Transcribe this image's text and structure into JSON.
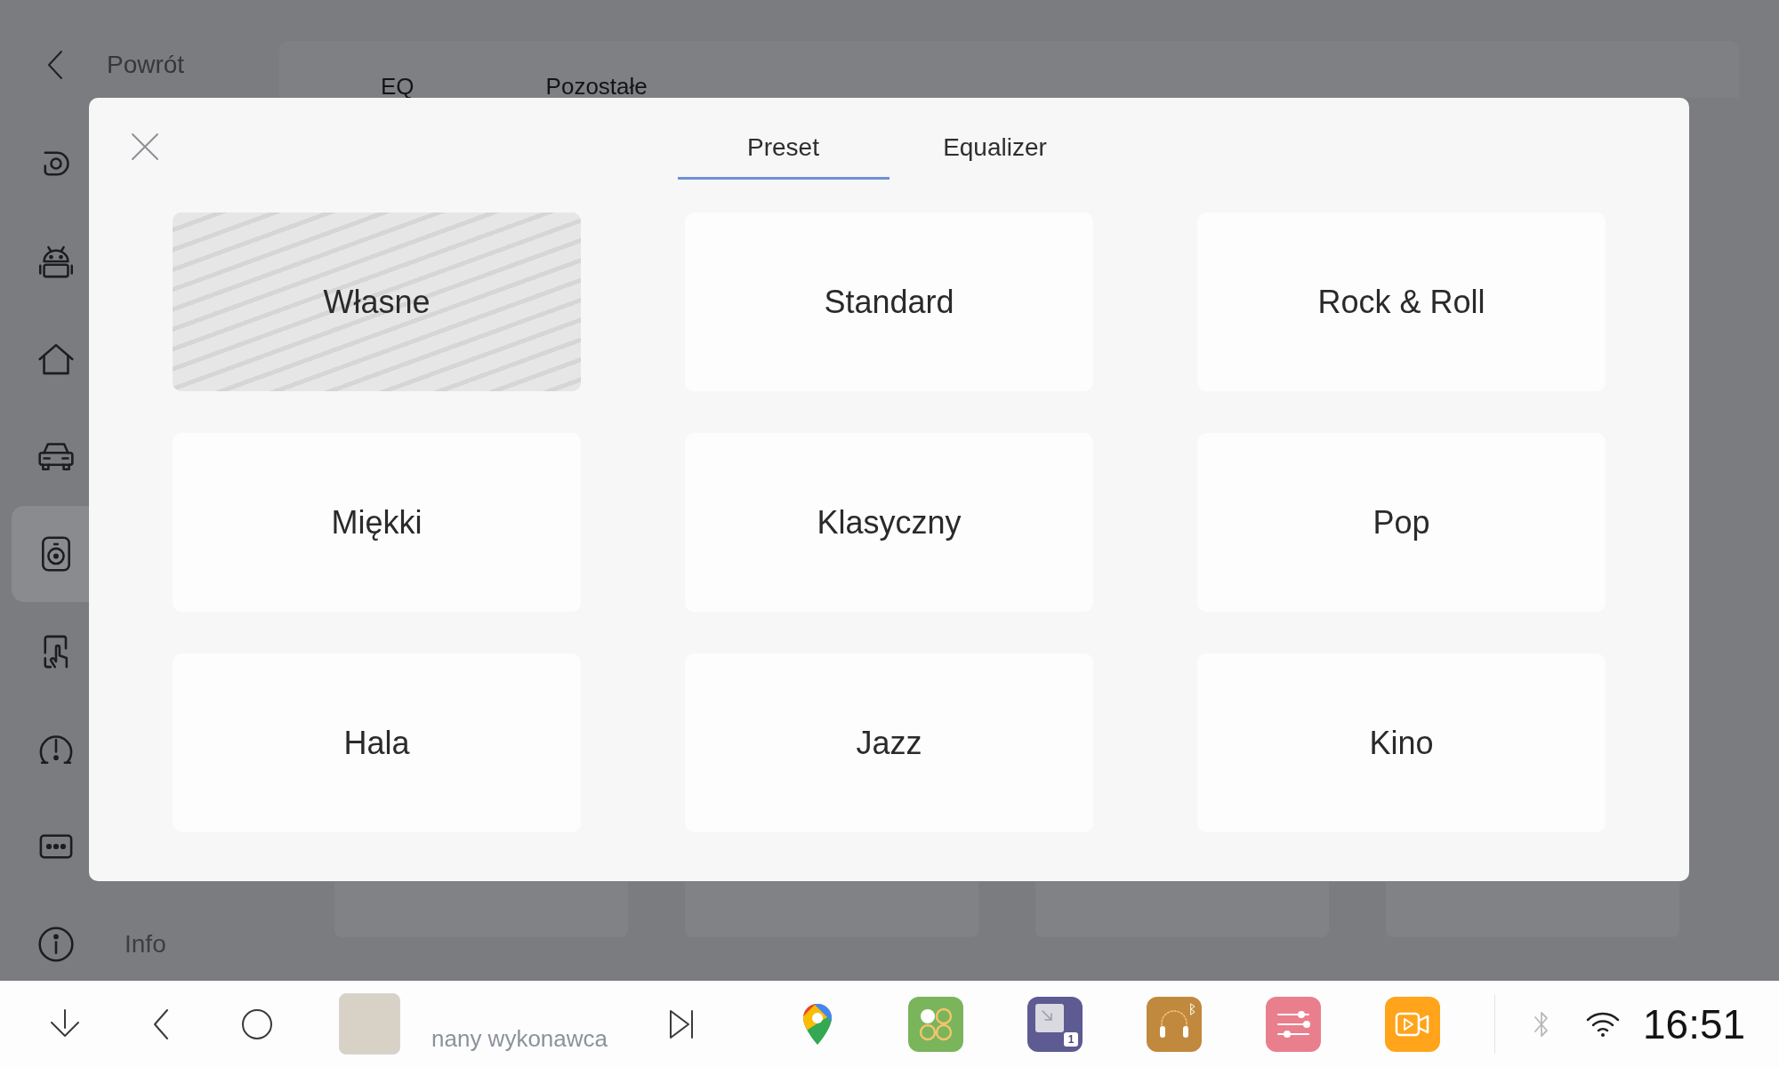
{
  "back_button": {
    "label": "Powrót"
  },
  "sidebar": {
    "items": [
      {
        "selected": false
      },
      {
        "selected": false
      },
      {
        "selected": false
      },
      {
        "selected": false
      },
      {
        "selected": true
      },
      {
        "selected": false
      },
      {
        "selected": false
      },
      {
        "selected": false
      },
      {
        "label": "Info",
        "selected": false
      }
    ]
  },
  "top_tabs": [
    {
      "label": "EQ"
    },
    {
      "label": "Pozostałe"
    }
  ],
  "dialog": {
    "tabs": [
      {
        "label": "Preset",
        "selected": true
      },
      {
        "label": "Equalizer",
        "selected": false
      }
    ],
    "presets": [
      {
        "label": "Własne",
        "selected": true
      },
      {
        "label": "Standard",
        "selected": false
      },
      {
        "label": "Rock & Roll",
        "selected": false
      },
      {
        "label": "Miękki",
        "selected": false
      },
      {
        "label": "Klasyczny",
        "selected": false
      },
      {
        "label": "Pop",
        "selected": false
      },
      {
        "label": "Hala",
        "selected": false
      },
      {
        "label": "Jazz",
        "selected": false
      },
      {
        "label": "Kino",
        "selected": false
      }
    ]
  },
  "taskbar": {
    "artist": "nany wykonawca",
    "app_badge": "1",
    "bluetooth_connected": false,
    "clock": "16:51"
  }
}
